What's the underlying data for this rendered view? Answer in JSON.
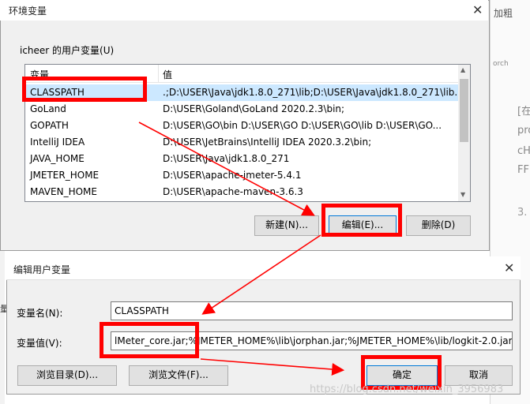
{
  "background": {
    "right_fragments": [
      "加粗",
      "orch",
      "[在",
      "pro",
      "cH",
      "FF",
      "3."
    ],
    "left_fragments": [
      "量",
      "变",
      "户",
      "量"
    ]
  },
  "env_dialog": {
    "title": "环境变量",
    "group_label": "icheer 的用户变量(U)",
    "columns": {
      "name": "变量",
      "value": "值"
    },
    "rows": [
      {
        "name": "CLASSPATH",
        "value": ".;D:\\USER\\Java\\jdk1.8.0_271\\lib;D:\\USER\\Java\\jdk1.8.0_271\\lib..."
      },
      {
        "name": "GoLand",
        "value": "D:\\USER\\Goland\\GoLand 2020.2.3\\bin;"
      },
      {
        "name": "GOPATH",
        "value": "D:\\USER\\GO\\bin   D:\\USER\\GO    D:\\USER\\GO\\lib D:\\USER\\GO..."
      },
      {
        "name": "IntelliJ IDEA",
        "value": "D:\\USER\\JetBrains\\IntelliJ IDEA 2020.3.2\\bin;"
      },
      {
        "name": "JAVA_HOME",
        "value": "D:\\USER\\Java\\jdk1.8.0_271"
      },
      {
        "name": "JMETER_HOME",
        "value": "D:\\USER\\apache-jmeter-5.4.1"
      },
      {
        "name": "MAVEN_HOME",
        "value": "D:\\USER\\apache-maven-3.6.3"
      }
    ],
    "buttons": {
      "new": "新建(N)...",
      "edit": "编辑(E)...",
      "delete": "删除(D)"
    }
  },
  "edit_dialog": {
    "title": "编辑用户变量",
    "name_label": "变量名(N):",
    "name_value": "CLASSPATH",
    "value_label": "变量值(V):",
    "value_value": "lMeter_core.jar;%JMETER_HOME%\\lib\\jorphan.jar;%JMETER_HOME%\\lib/logkit-2.0.jar",
    "buttons": {
      "browse_dir": "浏览目录(D)...",
      "browse_file": "浏览文件(F)...",
      "ok": "确定",
      "cancel": "取消"
    }
  },
  "watermark": "https://blog.csdn.net/weixin_3956983",
  "colors": {
    "annotation": "#ff0000",
    "selection": "#cce8ff"
  }
}
